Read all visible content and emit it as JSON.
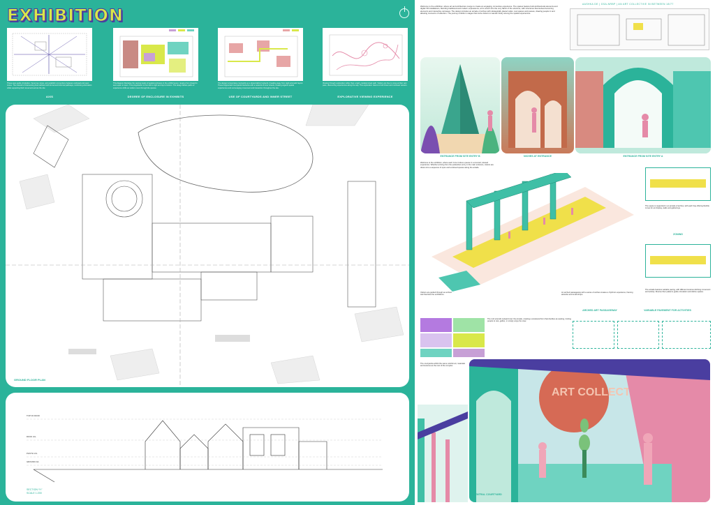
{
  "title": "EXHIBITION",
  "diagrams": [
    {
      "caption": "AXIS",
      "text": "These axes guide circulation, frame key views, and establish connections between enclosed and open zones. The network of intersecting lines defines both formal and informal pathways, reinforcing orientation while supporting fluid movement across the site."
    },
    {
      "caption": "DEGREE OF ENCLOSURE IN EXHIBITS",
      "text": "This diagram illustrates the varying levels of spatial enclosure in the exhibit layout, ranging from closed to semi-open to open. This progression is from left to right and top to bottom. The design allows paths of experience shifts as visitors move through the spaces.",
      "legend": [
        "#c7a0d6",
        "#d9e84a",
        "#6fd3c1"
      ]
    },
    {
      "caption": "USE OF COURTYARDS AND INNER STREET",
      "text": "The design incorporates courtyards as a decentralized network, breaking away from rigid axiomatic layout. These fragmented courtyards intertwine with a network of inner streets, creating organic spatial experiences and encouraging movement and interaction throughout the site.",
      "legend": [
        "#e7a6a6",
        "#d9e84a"
      ]
    },
    {
      "caption": "EXPLORATIVE VIEWING EXPERIENCE",
      "text": "Viewing through exploration rather than a rigid, predetermined path. Visitors are free to move at their own pace, discovering experiences along the way. This exploration caters to both linear and nonlinear viewers."
    }
  ],
  "plan_caption": "GROUND FLOOR PLAN",
  "section": {
    "caption_line1": "SECTION YY'",
    "caption_line2": "SCALE 1:200",
    "levels": [
      "TOP OF ROOF",
      "ROOF LVL",
      "PLINTH LVL",
      "GROUND LVL"
    ]
  },
  "header": "AASHKA DE | GSA-NRBP | AN ART COLLECTIVE IN BETWEEN   18/77",
  "intro": "Welcome to the exhibition, where art and architecture merge to create an engaging, immersive experience. The spaces feature bold architectural elements and digital VR installations, blending traditional and modern expressions, art is woven into the very fabric of the structure, with structures themselves becoming elements and interactive canvases. The design includes an arcade of arches with strategically placed cafes, rest spaces and pauses, drawing people in and allowing moments of reflection. The journey unfolds in stages that invite visitors to wander freely among the spatial experiences.",
  "renders": [
    {
      "caption": "ENTRANCE FROM SITE ENTRY B"
    },
    {
      "caption": "NICHES AT ENTRANCE"
    },
    {
      "caption": "ENTRANCE FROM SITE ENTRY A"
    }
  ],
  "mid_text": "Welcome to the exhibition, where each zone invites a pause in a covered, relaxed experience. Whether arriving from the pedestrian entry or the main entrance, visitors are drawn into a sequence of open and enclosed spaces along the arcade.",
  "arcade_caption": "ARCHED ART PASSAGEWAY",
  "arcade_text": "An arched passageway with a series of arches creates a rhythmic experience, framing artworks and small shops.",
  "visitors_text": "Visitors are guided through an arched trail that links the exhibitions.",
  "zoning_caption": "ZONING",
  "zoning_text": "The space is organized in an arcade of arches, with each bay offering flexible zones for art display, stalls and gatherings.",
  "pavement_caption": "VARIABLE PAVEMENT FOR ACTIVITIES",
  "pavement_text": "The arcade features variable paving, with different textures defining movement and activity. Diverse floor patterns guide circulation and define spaces.",
  "material_text": "The roof extends outward over the arcade, creating a sculptural form that doubles as seating, inviting people to rest, gather, or simply enjoy the view.",
  "courtyard_text": "The courtyards exhibit the same colorful art, materials and textures as the rest of the complex.",
  "courtyard_caption": "CENTRAL COURTYARD",
  "balloon_text": "ART COLLECTIVE",
  "colors": {
    "green": "#2bb39a",
    "yellow": "#d9e84a",
    "violet": "#4a3ea0",
    "pink": "#e58aa8",
    "teal": "#4ec6b0"
  }
}
